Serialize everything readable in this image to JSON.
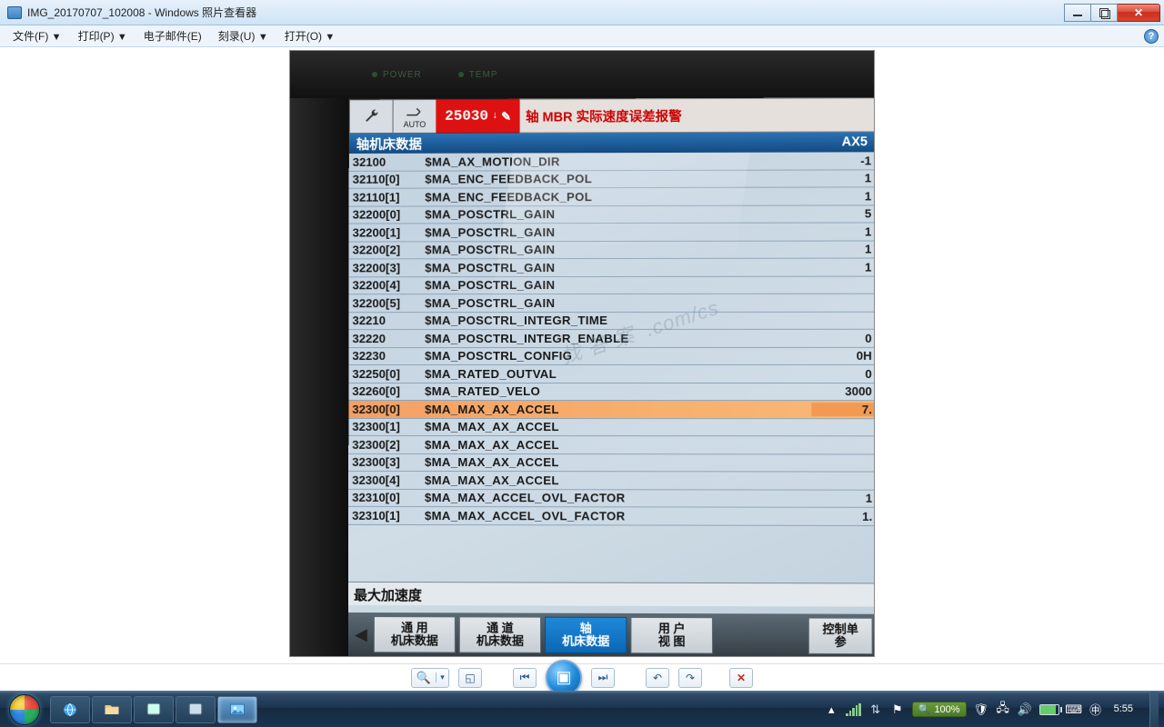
{
  "window": {
    "title": "IMG_20170707_102008 - Windows 照片查看器"
  },
  "menu": {
    "file": "文件(F)",
    "print": "打印(P)",
    "email": "电子邮件(E)",
    "burn": "刻录(U)",
    "open": "打开(O)"
  },
  "cnc": {
    "auto_label": "AUTO",
    "alarm_code": "25030",
    "alarm_text": "轴 MBR 实际速度误差报警",
    "section_title": "轴机床数据",
    "axis_label": "AX5",
    "desc": "最大加速度",
    "params": [
      {
        "id": "32100",
        "name": "$MA_AX_MOTION_DIR",
        "val": "-1"
      },
      {
        "id": "32110[0]",
        "name": "$MA_ENC_FEEDBACK_POL",
        "val": "1"
      },
      {
        "id": "32110[1]",
        "name": "$MA_ENC_FEEDBACK_POL",
        "val": "1"
      },
      {
        "id": "32200[0]",
        "name": "$MA_POSCTRL_GAIN",
        "val": "5"
      },
      {
        "id": "32200[1]",
        "name": "$MA_POSCTRL_GAIN",
        "val": "1"
      },
      {
        "id": "32200[2]",
        "name": "$MA_POSCTRL_GAIN",
        "val": "1"
      },
      {
        "id": "32200[3]",
        "name": "$MA_POSCTRL_GAIN",
        "val": "1"
      },
      {
        "id": "32200[4]",
        "name": "$MA_POSCTRL_GAIN",
        "val": ""
      },
      {
        "id": "32200[5]",
        "name": "$MA_POSCTRL_GAIN",
        "val": ""
      },
      {
        "id": "32210",
        "name": "$MA_POSCTRL_INTEGR_TIME",
        "val": ""
      },
      {
        "id": "32220",
        "name": "$MA_POSCTRL_INTEGR_ENABLE",
        "val": "0"
      },
      {
        "id": "32230",
        "name": "$MA_POSCTRL_CONFIG",
        "val": "0H"
      },
      {
        "id": "32250[0]",
        "name": "$MA_RATED_OUTVAL",
        "val": "0"
      },
      {
        "id": "32260[0]",
        "name": "$MA_RATED_VELO",
        "val": "3000"
      },
      {
        "id": "32300[0]",
        "name": "$MA_MAX_AX_ACCEL",
        "val": "7.",
        "hl": true
      },
      {
        "id": "32300[1]",
        "name": "$MA_MAX_AX_ACCEL",
        "val": ""
      },
      {
        "id": "32300[2]",
        "name": "$MA_MAX_AX_ACCEL",
        "val": ""
      },
      {
        "id": "32300[3]",
        "name": "$MA_MAX_AX_ACCEL",
        "val": ""
      },
      {
        "id": "32300[4]",
        "name": "$MA_MAX_AX_ACCEL",
        "val": ""
      },
      {
        "id": "32310[0]",
        "name": "$MA_MAX_ACCEL_OVL_FACTOR",
        "val": "1"
      },
      {
        "id": "32310[1]",
        "name": "$MA_MAX_ACCEL_OVL_FACTOR",
        "val": "1."
      }
    ],
    "softkeys": {
      "k1a": "通  用",
      "k1b": "机床数据",
      "k2a": "通  道",
      "k2b": "机床数据",
      "k3a": "轴",
      "k3b": "机床数据",
      "k4a": "用 户",
      "k4b": "视 图",
      "k5a": "控制单",
      "k5b": "参"
    },
    "leds": {
      "power": "POWER",
      "temp": "TEMP"
    }
  },
  "tray": {
    "zoom": "100%",
    "time": "5:55"
  }
}
